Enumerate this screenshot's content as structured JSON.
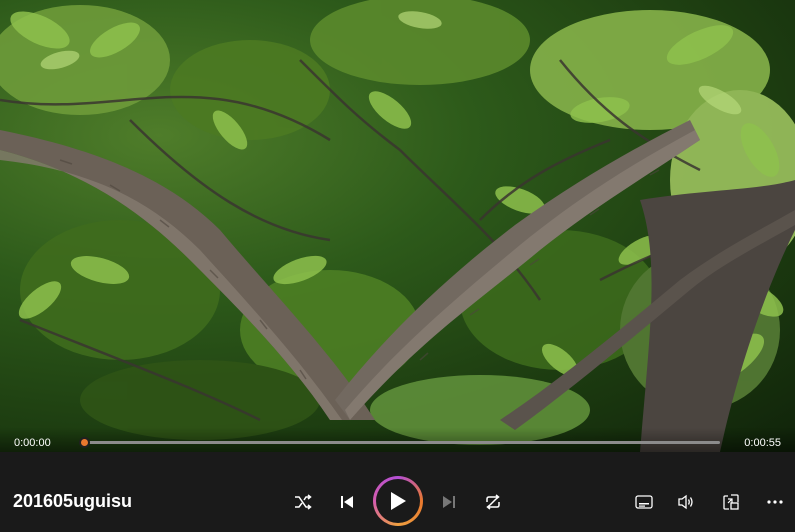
{
  "player": {
    "title": "201605uguisu",
    "current_time": "0:00:00",
    "duration": "0:00:55",
    "progress": 0.0,
    "accent_color": "#e8782e"
  },
  "controls": {
    "shuffle_icon": "shuffle-icon",
    "previous_icon": "skip-previous-icon",
    "play_icon": "play-icon",
    "next_icon": "skip-next-icon",
    "repeat_icon": "repeat-icon",
    "captions_icon": "captions-icon",
    "volume_icon": "volume-icon",
    "miniplayer_icon": "miniplayer-icon",
    "more_icon": "more-options-icon"
  }
}
